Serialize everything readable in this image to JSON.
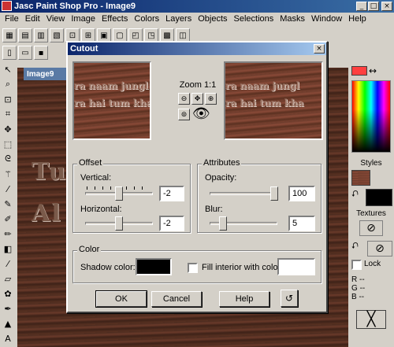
{
  "app": {
    "title": "Jasc Paint Shop Pro - Image9",
    "image_tab": "Image9"
  },
  "menu": [
    "File",
    "Edit",
    "View",
    "Image",
    "Effects",
    "Colors",
    "Layers",
    "Objects",
    "Selections",
    "Masks",
    "Window",
    "Help"
  ],
  "canvas": {
    "line1": "Tu",
    "line2": "Al"
  },
  "palette": {
    "styles_label": "Styles",
    "textures_label": "Textures",
    "lock_label": "Lock",
    "r_label": "R",
    "g_label": "G",
    "b_label": "B",
    "r_value": "--",
    "g_value": "--",
    "b_value": "--"
  },
  "dialog": {
    "title": "Cutout",
    "zoom_label": "Zoom 1:1",
    "preview_text_line1": "ra naam jungl",
    "preview_text_line2": "ra hai tum kha",
    "offset": {
      "label": "Offset",
      "vertical_label": "Vertical:",
      "vertical_value": "-2",
      "horizontal_label": "Horizontal:",
      "horizontal_value": "-2"
    },
    "attributes": {
      "label": "Attributes",
      "opacity_label": "Opacity:",
      "opacity_value": "100",
      "blur_label": "Blur:",
      "blur_value": "5"
    },
    "color": {
      "label": "Color",
      "shadow_label": "Shadow color:",
      "fill_interior_label": "Fill interior with color:",
      "fill_interior_checked": false,
      "shadow_color": "#000000",
      "fill_color": "#ffffff"
    },
    "buttons": {
      "ok": "OK",
      "cancel": "Cancel",
      "help": "Help"
    }
  }
}
